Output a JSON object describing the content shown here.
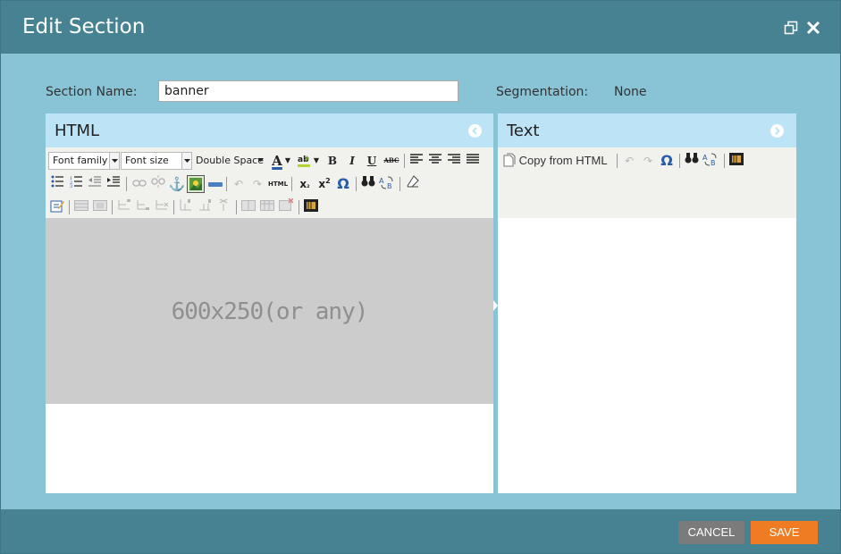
{
  "dialog": {
    "title": "Edit Section",
    "restore_icon": "restore-window-icon",
    "close_icon": "close-icon"
  },
  "form": {
    "section_name_label": "Section Name:",
    "section_name_value": "banner",
    "segmentation_label": "Segmentation:",
    "segmentation_value": "None"
  },
  "html_panel": {
    "title": "HTML",
    "collapse_icon": "arrow-left-circle-icon",
    "font_family": "Font family",
    "font_size": "Font size",
    "line_spacing": "Double Space",
    "toolbar_row1": [
      "text-color",
      "highlight-color",
      "bold",
      "italic",
      "underline",
      "strikethrough",
      "align-left",
      "align-center",
      "align-right",
      "justify"
    ],
    "toolbar_row2": [
      "bullet-list",
      "numbered-list",
      "outdent",
      "indent",
      "link",
      "unlink",
      "anchor",
      "image",
      "horizontal-rule",
      "undo",
      "redo",
      "html-source",
      "subscript",
      "superscript",
      "special-character",
      "find",
      "replace",
      "clear-formatting"
    ],
    "toolbar_row3": [
      "edit-properties",
      "table-layout",
      "table-merge",
      "insert-row-before",
      "insert-row-after",
      "delete-row",
      "insert-col-before",
      "insert-col-after",
      "delete-col",
      "split-cells",
      "merge-cells",
      "delete-table",
      "insert-snippet"
    ],
    "html_label": "HTML",
    "bold_glyph": "B",
    "italic_glyph": "I",
    "underline_glyph": "U",
    "strike_glyph": "ABC",
    "text_color_glyph": "A",
    "omega_glyph": "Ω",
    "placeholder_text": "600x250(or any)"
  },
  "text_panel": {
    "title": "Text",
    "expand_icon": "arrow-right-circle-icon",
    "copy_from_html_label": "Copy from HTML",
    "omega_glyph": "Ω"
  },
  "footer": {
    "cancel_label": "CANCEL",
    "save_label": "SAVE"
  },
  "colors": {
    "titlebar": "#468291",
    "body": "#88c3d6",
    "panel_header": "#bde3f6",
    "save": "#ef7b22",
    "cancel": "#7b7b7b"
  }
}
